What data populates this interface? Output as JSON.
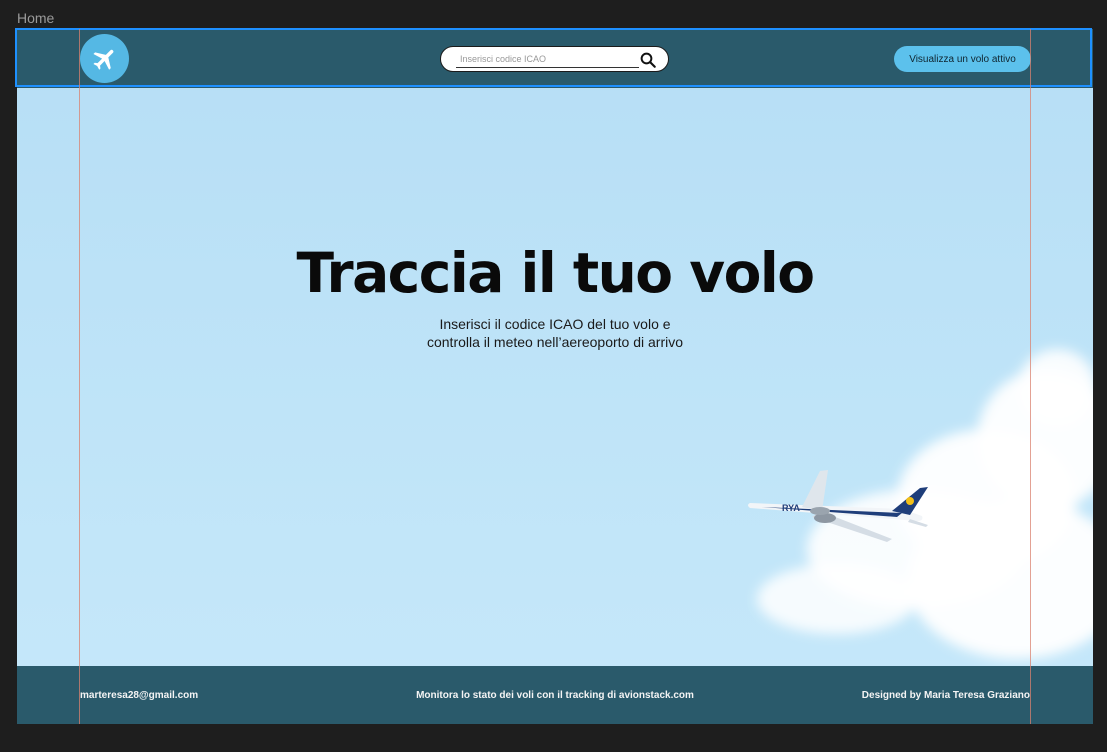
{
  "frame": {
    "label": "Home"
  },
  "header": {
    "logo_icon": "airplane-icon",
    "search": {
      "placeholder": "Inserisci codice ICAO",
      "value": ""
    },
    "search_icon": "search-icon",
    "cta_label": "Visualizza un volo attivo"
  },
  "hero": {
    "title": "Traccia il tuo volo",
    "subtitle_line1": "Inserisci il codice ICAO del tuo volo e",
    "subtitle_line2": "controlla il meteo nell’aereoporto di arrivo"
  },
  "footer": {
    "email": "marteresa28@gmail.com",
    "tagline": "Monitora lo stato dei voli con il tracking di avionstack.com",
    "credit": "Designed by Maria Teresa Graziano"
  },
  "colors": {
    "header_bg": "#2a5a6b",
    "sky": "#bfe4f8",
    "accent": "#5cc1ec",
    "selection": "#1e90ff"
  }
}
